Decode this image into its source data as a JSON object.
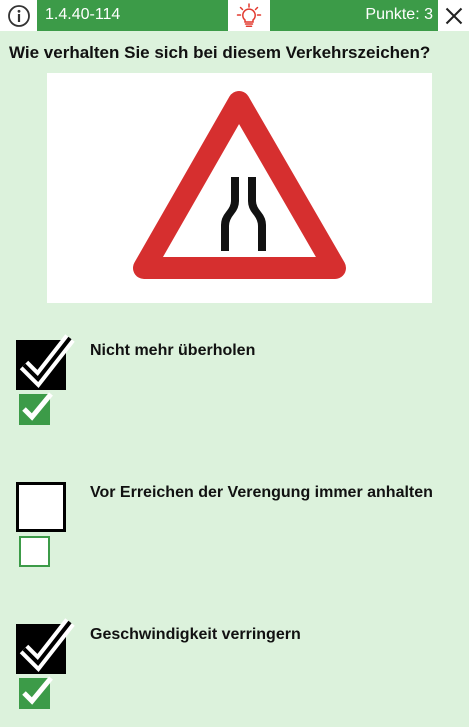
{
  "header": {
    "question_id": "1.4.40-114",
    "points_label": "Punkte: 3",
    "info_icon": "info-icon",
    "hint_icon": "lightbulb-icon",
    "close_icon": "close-icon",
    "accent_color": "#3c9b48",
    "hint_icon_color": "#e23a2f"
  },
  "question": {
    "text": "Wie verhalten Sie sich bei diesem Verkehrszeichen?",
    "sign_icon": "road-narrows-warning-sign",
    "background_color": "#dcf2dc"
  },
  "answers": [
    {
      "text": "Nicht mehr überholen",
      "selected": true,
      "correct": true
    },
    {
      "text": "Vor Erreichen der Verengung immer anhalten",
      "selected": false,
      "correct": false
    },
    {
      "text": "Geschwindigkeit verringern",
      "selected": true,
      "correct": true
    }
  ]
}
